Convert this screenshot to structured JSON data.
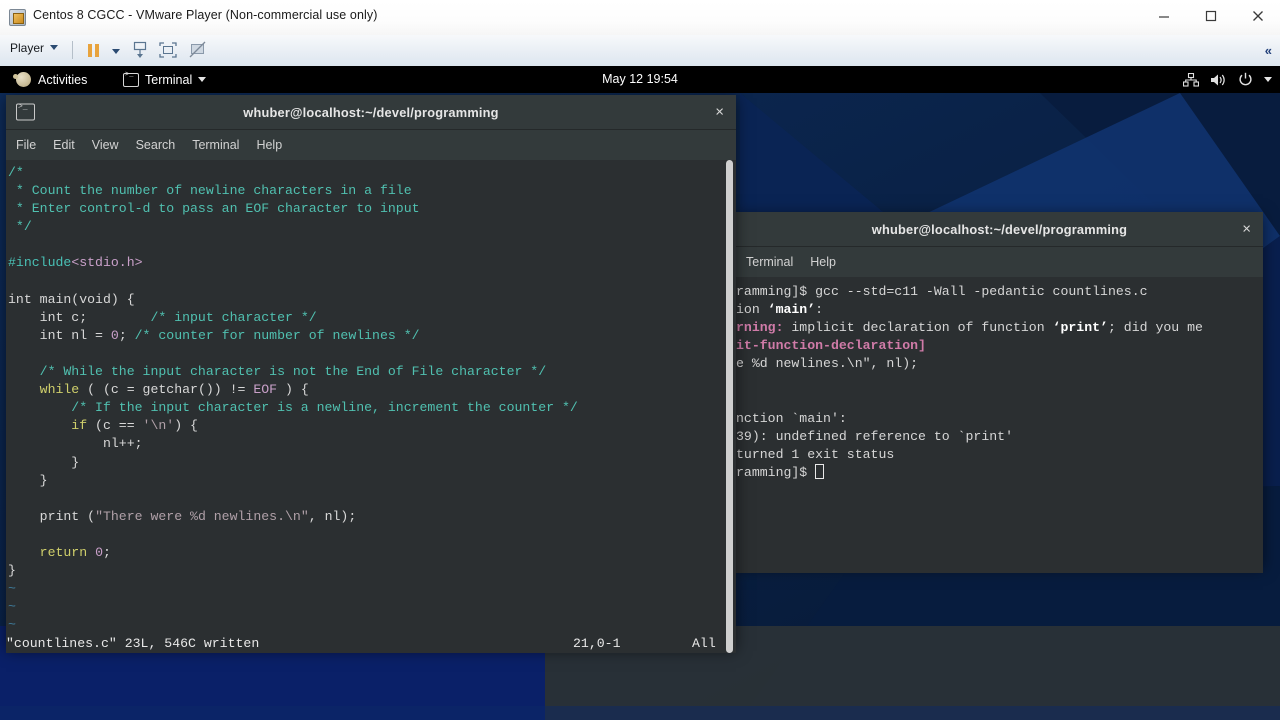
{
  "vmware": {
    "title": "Centos 8 CGCC - VMware Player (Non-commercial use only)",
    "app_icon": "vmware-icon",
    "window_buttons": {
      "minimize": "minimize-icon",
      "maximize": "maximize-icon",
      "close": "close-icon"
    },
    "toolbar": {
      "player_menu": "Player",
      "pause_button": "pause-icon",
      "pause_dropdown": "chevron-down-icon",
      "usb_button": "usb-devices-icon",
      "fullscreen_button": "fullscreen-icon",
      "unity_button": "unity-mode-icon",
      "collapse": "«"
    }
  },
  "gnome": {
    "activities": "Activities",
    "app_menu": "Terminal",
    "clock": "May 12  19:54",
    "tray": [
      "network-icon",
      "volume-icon",
      "power-icon",
      "chevron-down-icon"
    ]
  },
  "vim_window": {
    "title": "whuber@localhost:~/devel/programming",
    "close": "×",
    "menus": [
      "File",
      "Edit",
      "View",
      "Search",
      "Terminal",
      "Help"
    ],
    "file_name": "countlines.c",
    "status_left": "\"countlines.c\" 23L, 546C written",
    "status_pos": "21,0-1",
    "status_view": "All",
    "code_lines": [
      "/*",
      " * Count the number of newline characters in a file",
      " * Enter control-d to pass an EOF character to input",
      " */",
      "",
      "#include<stdio.h>",
      "",
      "int main(void) {",
      "    int c;        /* input character */",
      "    int nl = 0; /* counter for number of newlines */",
      "",
      "    /* While the input character is not the End of File character */",
      "    while ( (c = getchar()) != EOF ) {",
      "        /* If the input character is a newline, increment the counter */",
      "        if (c == '\\n') {",
      "            nl++;",
      "        }",
      "    }",
      "",
      "    print (\"There were %d newlines.\\n\", nl);",
      "",
      "    return 0;",
      "}",
      "~",
      "~",
      "~"
    ]
  },
  "gcc_window": {
    "title": "whuber@localhost:~/devel/programming",
    "close": "×",
    "menus_visible": [
      "Terminal",
      "Help"
    ],
    "output_lines": [
      "ramming]$ gcc --std=c11 -Wall -pedantic countlines.c",
      "ion ‘main’:",
      "rning: implicit declaration of function ‘print’; did you me",
      "it-function-declaration]",
      "e %d newlines.\\n\", nl);",
      "",
      "",
      "nction `main':",
      "39): undefined reference to `print'",
      "turned 1 exit status",
      "ramming]$ "
    ]
  },
  "colors": {
    "vmware_titlebar": "#ffffff",
    "gnome_topbar": "#000000",
    "terminal_bg": "#2b2f31",
    "terminal_titlebar": "#333a3b",
    "comment": "#50c0b0",
    "keyword": "#cfcf6b",
    "string": "#b0a0a8",
    "warning": "#d07ba8",
    "wallpaper": "#0b1f4a"
  }
}
